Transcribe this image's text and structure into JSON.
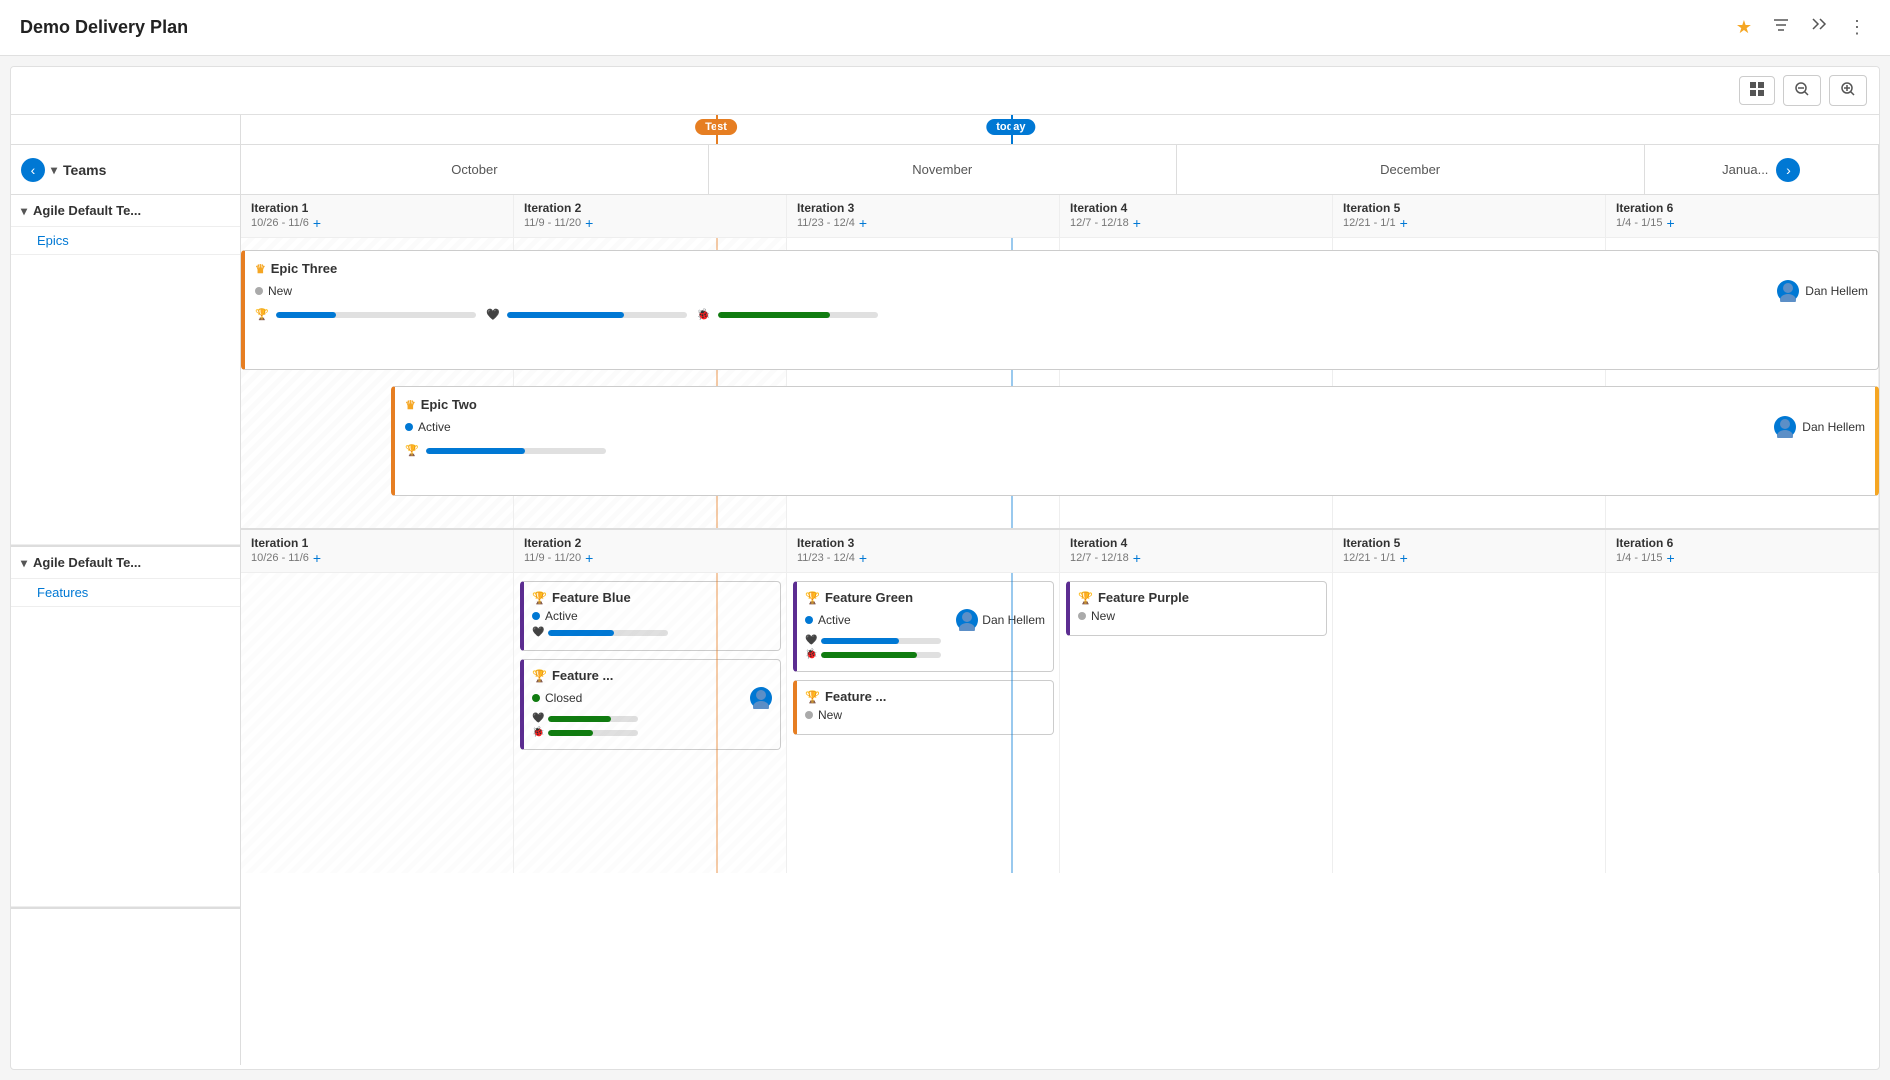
{
  "app": {
    "title": "Demo Delivery Plan"
  },
  "header": {
    "star_label": "★",
    "filter_label": "⊿",
    "collapse_label": "⤡",
    "more_label": "⋮"
  },
  "toolbar": {
    "grid_icon": "☰",
    "zoom_out_icon": "−",
    "zoom_in_icon": "+"
  },
  "timeline": {
    "teams_label": "Teams",
    "nav_prev": "‹",
    "nav_next": "›",
    "months": [
      "October",
      "November",
      "December",
      "Janua..."
    ],
    "markers": {
      "test_label": "Test",
      "today_label": "today"
    }
  },
  "teams": [
    {
      "name": "Agile Default Te...",
      "sub_label": "Epics",
      "iterations": [
        {
          "name": "Iteration 1",
          "dates": "10/26 - 11/6"
        },
        {
          "name": "Iteration 2",
          "dates": "11/9 - 11/20"
        },
        {
          "name": "Iteration 3",
          "dates": "11/23 - 12/4"
        },
        {
          "name": "Iteration 4",
          "dates": "12/7 - 12/18"
        },
        {
          "name": "Iteration 5",
          "dates": "12/21 - 1/1"
        },
        {
          "name": "Iteration 6",
          "dates": "1/4 - 1/15"
        }
      ],
      "epics": [
        {
          "id": "epic-three",
          "title": "Epic Three",
          "subtitle": "New",
          "status": "new",
          "assignee": "Dan Hellem",
          "assignee_initials": "DH",
          "bar1_pct": 30,
          "bar2_pct": 65,
          "bar3_pct": 70,
          "has_crown": true,
          "has_bug": true
        },
        {
          "id": "epic-two",
          "title": "Epic Two",
          "subtitle": "Active",
          "status": "active",
          "assignee": "Dan Hellem",
          "assignee_initials": "DH",
          "bar1_pct": 55,
          "has_crown": true
        }
      ]
    },
    {
      "name": "Agile Default Te...",
      "sub_label": "Features",
      "iterations": [
        {
          "name": "Iteration 1",
          "dates": "10/26 - 11/6"
        },
        {
          "name": "Iteration 2",
          "dates": "11/9 - 11/20"
        },
        {
          "name": "Iteration 3",
          "dates": "11/23 - 12/4"
        },
        {
          "name": "Iteration 4",
          "dates": "12/7 - 12/18"
        },
        {
          "name": "Iteration 5",
          "dates": "12/21 - 1/1"
        },
        {
          "name": "Iteration 6",
          "dates": "1/4 - 1/15"
        }
      ],
      "features": {
        "iter2": [
          {
            "id": "feature-blue",
            "title": "Feature Blue",
            "status": "active",
            "status_label": "Active",
            "bar1_pct": 55,
            "bar1_color": "blue",
            "has_crown": true,
            "border_color": "#5c2d91"
          }
        ],
        "iter3": [
          {
            "id": "feature-green",
            "title": "Feature Green",
            "status": "active",
            "status_label": "Active",
            "assignee": "Dan Hellem",
            "assignee_initials": "DH",
            "bar1_pct": 65,
            "bar1_color": "blue",
            "bar2_pct": 80,
            "bar2_color": "green",
            "has_crown": true,
            "border_color": "#5c2d91"
          }
        ],
        "iter2_row2": [
          {
            "id": "feature-dot2",
            "title": "Feature ...",
            "status": "closed",
            "status_label": "Closed",
            "bar1_pct": 70,
            "bar2_pct": 50,
            "has_crown": true,
            "border_color": "#5c2d91",
            "has_assignee": true,
            "assignee_initials": "DH"
          }
        ],
        "iter3_row2": [
          {
            "id": "feature-dot3",
            "title": "Feature ...",
            "status": "new",
            "status_label": "New",
            "has_crown": true,
            "border_color": "#e67e22"
          }
        ],
        "iter3b_row2": [
          {
            "id": "feature-purple",
            "title": "Feature Purple",
            "status": "new",
            "status_label": "New",
            "has_crown": true,
            "border_color": "#5c2d91"
          }
        ]
      }
    }
  ]
}
